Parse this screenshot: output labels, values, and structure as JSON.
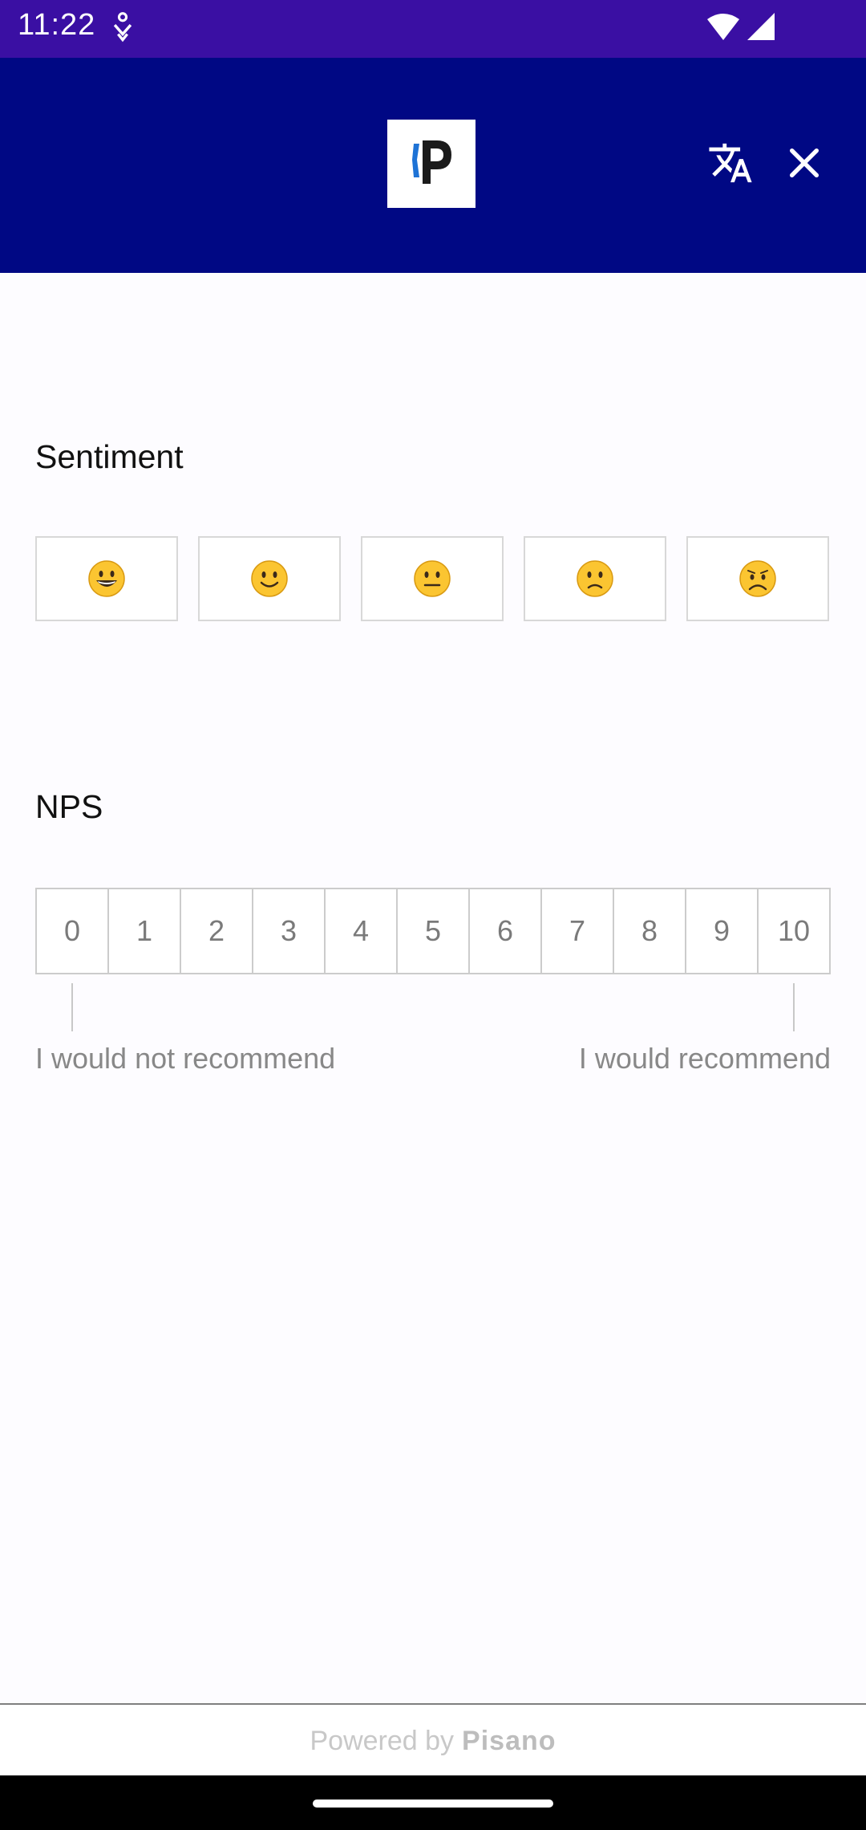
{
  "status_bar": {
    "time": "11:22",
    "icons": [
      "notification-icon",
      "wifi-icon",
      "signal-icon"
    ]
  },
  "app_bar": {
    "logo": "P",
    "icons": [
      "translate-icon",
      "close-icon"
    ],
    "bg_color": "#000884"
  },
  "sentiment": {
    "title": "Sentiment",
    "options": [
      "grinning-face-icon",
      "smiling-face-icon",
      "neutral-face-icon",
      "slightly-frowning-face-icon",
      "frowning-face-icon"
    ]
  },
  "nps": {
    "title": "NPS",
    "values": [
      "0",
      "1",
      "2",
      "3",
      "4",
      "5",
      "6",
      "7",
      "8",
      "9",
      "10"
    ],
    "low_label": "I would not recommend",
    "high_label": "I would recommend"
  },
  "footer": {
    "prefix": "Powered by",
    "brand": "Pisano"
  }
}
